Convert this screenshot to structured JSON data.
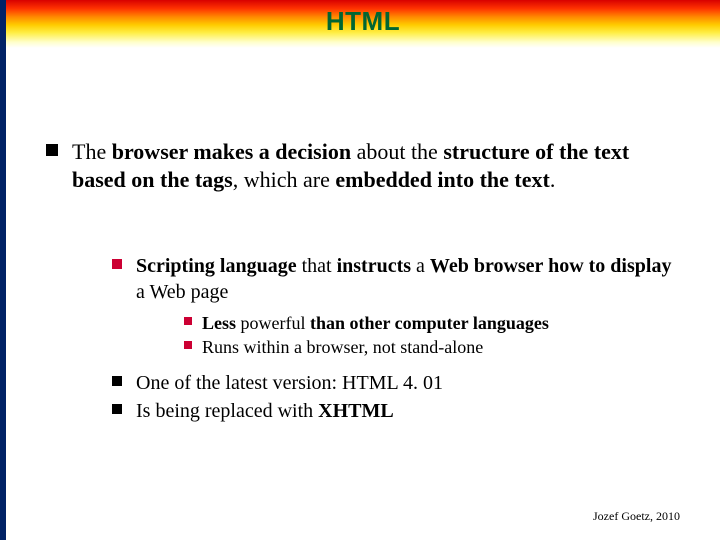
{
  "title": "HTML",
  "main_bullet_html": "The <b>browser makes a decision</b> about the <b>structure of the text based on the tags</b>, which are <b>embedded into the text</b>.",
  "sub_scripting_html": "<b>Scripting language</b> that <b>instructs</b> a <b>Web browser how to display</b> a Web page",
  "sub2_a_html": "<b>Less</b> powerful <b>than other computer languages</b>",
  "sub2_b_html": "Runs within a browser, not stand-alone",
  "sub_latest": "One of the latest version: HTML 4. 01",
  "sub_replaced_html": "Is being replaced with <b>XHTML</b>",
  "footer": "Jozef Goetz, 2010"
}
